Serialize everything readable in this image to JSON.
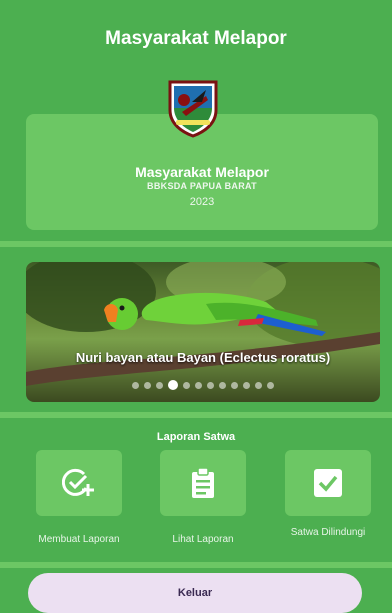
{
  "header": {
    "title": "Masyarakat Melapor"
  },
  "hero": {
    "title": "Masyarakat Melapor",
    "subtitle": "BBKSDA PAPUA BARAT",
    "year": "2023"
  },
  "carousel": {
    "caption": "Nuri bayan atau Bayan (Eclectus roratus)",
    "total_slides": 12,
    "active_slide": 4
  },
  "reports": {
    "section_title": "Laporan Satwa",
    "items": [
      {
        "label": "Membuat Laporan",
        "icon": "check-plus-icon"
      },
      {
        "label": "Lihat Laporan",
        "icon": "clipboard-icon"
      },
      {
        "label": "Satwa Dilindungi",
        "icon": "check-box-icon"
      }
    ]
  },
  "footer": {
    "logout_label": "Keluar"
  },
  "colors": {
    "background": "#4caf50",
    "card": "#6cc764",
    "button": "#ece0f2",
    "button_text": "#3a2a52"
  }
}
